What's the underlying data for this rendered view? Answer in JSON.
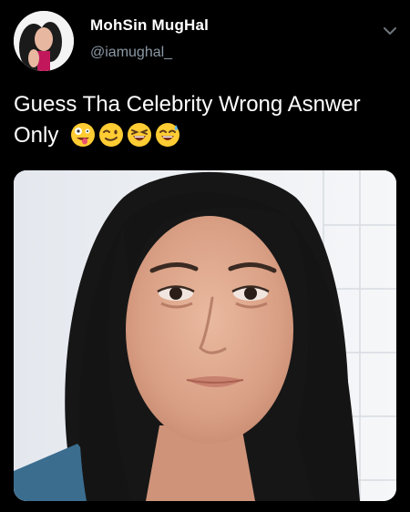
{
  "author": {
    "display_name": "MohSin MugHal",
    "handle": "@iamughal_"
  },
  "tweet": {
    "text": "Guess Tha Celebrity Wrong Asnwer Only"
  },
  "icons": {
    "menu": "chevron-down-icon",
    "emojis": [
      "zany-face-emoji",
      "winking-face-emoji",
      "laughing-face-emoji",
      "sweat-smile-emoji"
    ]
  },
  "colors": {
    "background": "#000000",
    "text": "#ffffff",
    "secondary_text": "#8b98a5",
    "emoji_yellow": "#ffcc33"
  }
}
